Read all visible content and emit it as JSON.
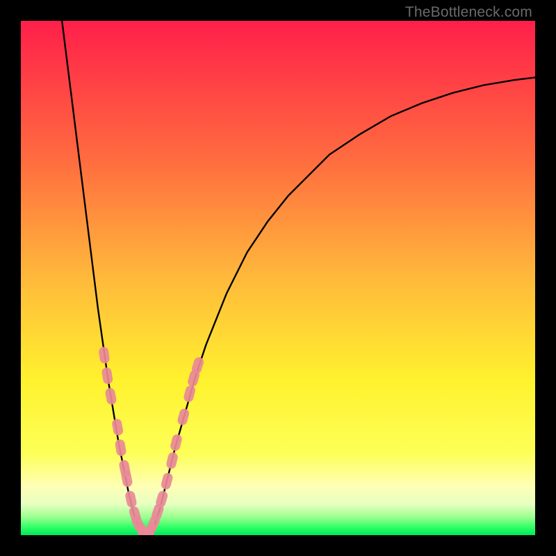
{
  "watermark": "TheBottleneck.com",
  "colors": {
    "frame": "#000000",
    "curve": "#000000",
    "marker_fill": "#e98997",
    "marker_stroke": "#e98997",
    "grad_stops": [
      {
        "offset": 0.0,
        "color": "#ff1f4a"
      },
      {
        "offset": 0.28,
        "color": "#ff6f3f"
      },
      {
        "offset": 0.5,
        "color": "#ffb93b"
      },
      {
        "offset": 0.7,
        "color": "#fff22e"
      },
      {
        "offset": 0.84,
        "color": "#fdff57"
      },
      {
        "offset": 0.905,
        "color": "#feffb5"
      },
      {
        "offset": 0.94,
        "color": "#e7ffc0"
      },
      {
        "offset": 0.965,
        "color": "#9bff8f"
      },
      {
        "offset": 0.985,
        "color": "#2eff66"
      },
      {
        "offset": 1.0,
        "color": "#00e85a"
      }
    ]
  },
  "chart_data": {
    "type": "line",
    "title": "",
    "xlabel": "",
    "ylabel": "",
    "xlim": [
      0,
      100
    ],
    "ylim": [
      0,
      100
    ],
    "series": [
      {
        "name": "bottleneck-curve",
        "x": [
          8,
          9,
          10,
          11,
          12,
          13,
          14,
          15,
          16,
          17,
          18,
          19,
          20,
          21,
          22,
          23,
          24,
          25,
          26,
          27,
          28,
          30,
          32,
          34,
          36,
          38,
          40,
          44,
          48,
          52,
          56,
          60,
          66,
          72,
          78,
          84,
          90,
          96,
          100
        ],
        "y": [
          100,
          92,
          84,
          76,
          68,
          60,
          52,
          44,
          37,
          30,
          24,
          18,
          13,
          8,
          4,
          1.5,
          0.4,
          0.5,
          2,
          5,
          9,
          17,
          24,
          31,
          37,
          42,
          47,
          55,
          61,
          66,
          70,
          74,
          78,
          81.5,
          84,
          86,
          87.5,
          88.5,
          89
        ]
      }
    ],
    "markers": {
      "name": "sample-points",
      "points": [
        {
          "x": 16.2,
          "y": 35
        },
        {
          "x": 16.8,
          "y": 31
        },
        {
          "x": 17.5,
          "y": 27
        },
        {
          "x": 18.8,
          "y": 21
        },
        {
          "x": 19.4,
          "y": 17
        },
        {
          "x": 20.2,
          "y": 13
        },
        {
          "x": 20.6,
          "y": 11
        },
        {
          "x": 21.4,
          "y": 7
        },
        {
          "x": 22.2,
          "y": 4
        },
        {
          "x": 22.8,
          "y": 2.2
        },
        {
          "x": 23.6,
          "y": 1.0
        },
        {
          "x": 24.3,
          "y": 0.5
        },
        {
          "x": 25.0,
          "y": 0.8
        },
        {
          "x": 25.8,
          "y": 2.3
        },
        {
          "x": 26.6,
          "y": 4.5
        },
        {
          "x": 27.4,
          "y": 7.0
        },
        {
          "x": 28.4,
          "y": 10.5
        },
        {
          "x": 29.4,
          "y": 14.5
        },
        {
          "x": 30.2,
          "y": 18
        },
        {
          "x": 31.6,
          "y": 23
        },
        {
          "x": 32.8,
          "y": 27.5
        },
        {
          "x": 33.6,
          "y": 30.5
        },
        {
          "x": 34.4,
          "y": 33
        }
      ]
    }
  }
}
